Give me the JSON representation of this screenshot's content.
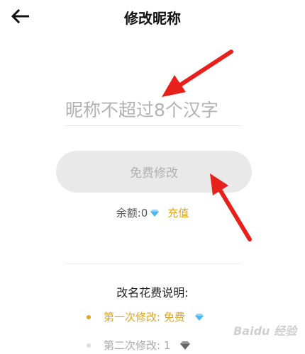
{
  "header": {
    "title": "修改昵称"
  },
  "nickname": {
    "placeholder": "昵称不超过8个汉字",
    "value": ""
  },
  "free_button": {
    "label": "免费修改"
  },
  "balance": {
    "label": "余额:",
    "amount": "0",
    "recharge": "充值"
  },
  "explain": {
    "title": "改名花费说明:",
    "rules": [
      {
        "text": "第一次修改: 免费"
      },
      {
        "text": "第二次修改: 1"
      }
    ]
  },
  "watermark": {
    "text": "Baidu 经验"
  },
  "colors": {
    "accent": "#e6a41d",
    "gem": "#49b8f0",
    "arrow": "#e8201c"
  }
}
